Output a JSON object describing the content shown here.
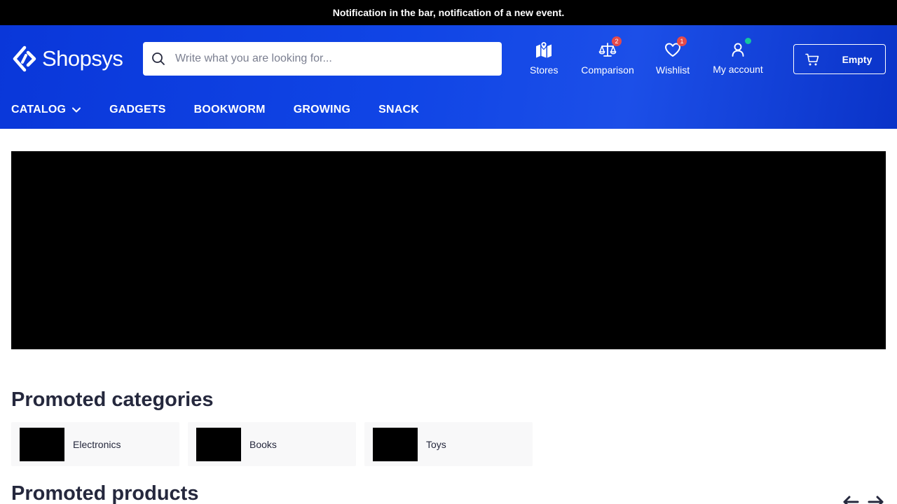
{
  "notification": {
    "text": "Notification in the bar, notification of a new event."
  },
  "logo": {
    "text": "Shopsys"
  },
  "search": {
    "placeholder": "Write what you are looking for..."
  },
  "header_items": {
    "stores": {
      "label": "Stores",
      "icon": "map-icon"
    },
    "comparison": {
      "label": "Comparison",
      "icon": "scales-icon",
      "count": "2"
    },
    "wishlist": {
      "label": "Wishlist",
      "icon": "heart-icon",
      "count": "1"
    },
    "account": {
      "label": "My account",
      "icon": "user-icon"
    }
  },
  "cart": {
    "label": "Empty",
    "icon": "cart-icon"
  },
  "nav": {
    "items": [
      {
        "label": "CATALOG"
      },
      {
        "label": "GADGETS"
      },
      {
        "label": "BOOKWORM"
      },
      {
        "label": "GROWING"
      },
      {
        "label": "SNACK"
      }
    ]
  },
  "promoted_categories": {
    "title": "Promoted categories",
    "items": [
      {
        "label": "Electronics"
      },
      {
        "label": "Books"
      },
      {
        "label": "Toys"
      }
    ]
  },
  "promoted_products": {
    "title": "Promoted products"
  },
  "colors": {
    "header_blue": "#1045e6",
    "notification_bg": "#000000",
    "badge_red": "#e54a4a",
    "status_green": "#14c79f",
    "text_dark": "#25283d"
  }
}
